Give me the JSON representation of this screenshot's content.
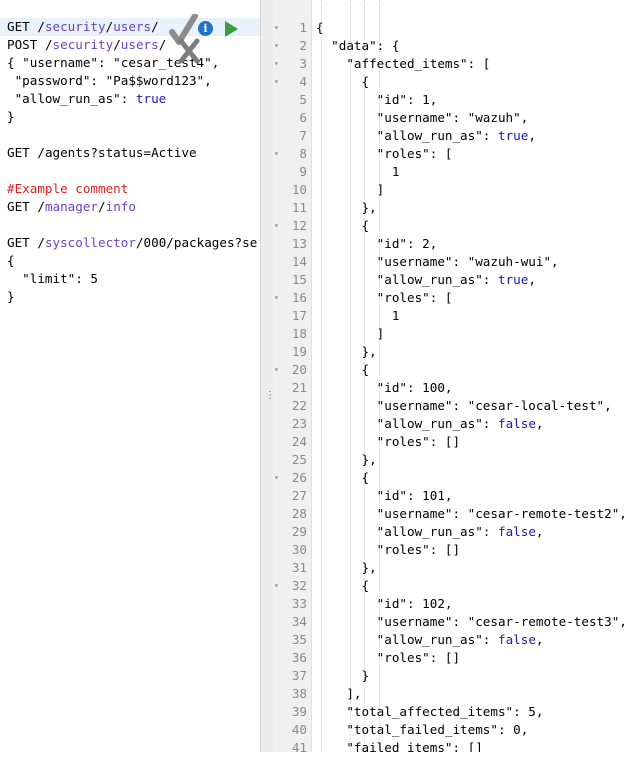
{
  "editor": {
    "lines": [
      {
        "text": "GET /security/users/",
        "method": "GET",
        "active": true
      },
      {
        "text": "POST /security/users/",
        "method": "POST"
      },
      {
        "text": "{ \"username\": \"cesar_test4\","
      },
      {
        "text": " \"password\": \"Pa$$word123\","
      },
      {
        "text": " \"allow_run_as\": true",
        "keyword": "true"
      },
      {
        "text": "}"
      },
      {
        "text": ""
      },
      {
        "text": "GET /agents?status=Active",
        "method": "GET"
      },
      {
        "text": ""
      },
      {
        "text": "#Example comment",
        "comment": true
      },
      {
        "text": "GET /manager/info",
        "method": "GET"
      },
      {
        "text": ""
      },
      {
        "text": "GET /syscollector/000/packages?se",
        "method": "GET"
      },
      {
        "text": "{"
      },
      {
        "text": "  \"limit\": 5"
      },
      {
        "text": "}"
      }
    ],
    "toolbar": {
      "check_icon": "check-icon",
      "info_icon": "info-icon",
      "info_label": "i",
      "run_icon": "play-icon",
      "cross_icon": "cross-icon",
      "run_color": "#3aa13a",
      "info_color": "#1f74c9"
    },
    "resizer_grip": "⋮"
  },
  "output": {
    "line_numbers": [
      "1",
      "2",
      "3",
      "4",
      "5",
      "6",
      "7",
      "8",
      "9",
      "10",
      "11",
      "12",
      "13",
      "14",
      "15",
      "16",
      "17",
      "18",
      "19",
      "20",
      "21",
      "22",
      "23",
      "24",
      "25",
      "26",
      "27",
      "28",
      "29",
      "30",
      "31",
      "32",
      "33",
      "34",
      "35",
      "36",
      "37",
      "38",
      "39",
      "40",
      "41"
    ],
    "fold_markers": [
      "1",
      "2",
      "3",
      "4",
      "8",
      "12",
      "16",
      "20",
      "26",
      "32"
    ],
    "lines": [
      "{",
      "  \"data\": {",
      "    \"affected_items\": [",
      "      {",
      "        \"id\": 1,",
      "        \"username\": \"wazuh\",",
      "        \"allow_run_as\": true,",
      "        \"roles\": [",
      "          1",
      "        ]",
      "      },",
      "      {",
      "        \"id\": 2,",
      "        \"username\": \"wazuh-wui\",",
      "        \"allow_run_as\": true,",
      "        \"roles\": [",
      "          1",
      "        ]",
      "      },",
      "      {",
      "        \"id\": 100,",
      "        \"username\": \"cesar-local-test\",",
      "        \"allow_run_as\": false,",
      "        \"roles\": []",
      "      },",
      "      {",
      "        \"id\": 101,",
      "        \"username\": \"cesar-remote-test2\",",
      "        \"allow_run_as\": false,",
      "        \"roles\": []",
      "      },",
      "      {",
      "        \"id\": 102,",
      "        \"username\": \"cesar-remote-test3\",",
      "        \"allow_run_as\": false,",
      "        \"roles\": []",
      "      }",
      "    ],",
      "    \"total_affected_items\": 5,",
      "    \"total_failed_items\": 0,",
      "    \"failed_items\": []"
    ]
  }
}
